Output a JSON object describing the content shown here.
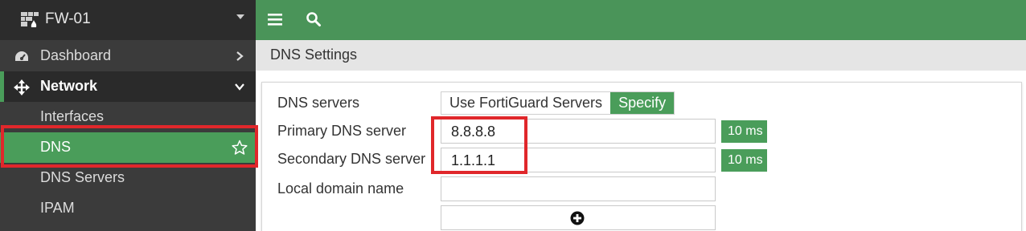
{
  "sidebar": {
    "device_name": "FW-01",
    "items": [
      {
        "label": "Dashboard",
        "icon": "dashboard-icon"
      },
      {
        "label": "Network",
        "icon": "move-arrows-icon"
      },
      {
        "label": "Interfaces"
      },
      {
        "label": "DNS",
        "icon": "star-icon"
      },
      {
        "label": "DNS Servers"
      },
      {
        "label": "IPAM"
      }
    ]
  },
  "topbar": {
    "menu_icon": "hamburger-icon",
    "search_icon": "search-icon"
  },
  "breadcrumb": {
    "title": "DNS Settings"
  },
  "form": {
    "dns_servers_label": "DNS servers",
    "option_fortiguard": "Use FortiGuard Servers",
    "option_specify": "Specify",
    "primary_label": "Primary DNS server",
    "primary_value": "8.8.8.8",
    "primary_latency": "10 ms",
    "secondary_label": "Secondary DNS server",
    "secondary_value": "1.1.1.1",
    "secondary_latency": "10 ms",
    "local_domain_label": "Local domain name",
    "local_domain_value": ""
  },
  "colors": {
    "accent": "#4a9d5a",
    "topbar": "#4a9459",
    "highlight": "#e0272b",
    "sidebar": "#3b3b3b"
  }
}
